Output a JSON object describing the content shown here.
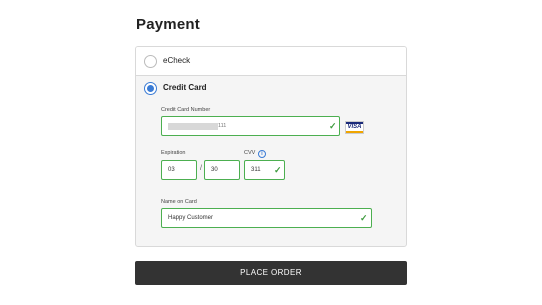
{
  "page_title": "Payment",
  "payment_options": {
    "echeck_label": "eCheck",
    "credit_card_label": "Credit Card",
    "selected": "Credit Card"
  },
  "card": {
    "number_label": "Credit Card Number",
    "number_suffix": "111",
    "brand": "VISA",
    "expiration_label": "Expiration",
    "exp_month": "03",
    "exp_separator": "/",
    "exp_year": "30",
    "cvv_label": "CVV",
    "cvv_value": "311",
    "name_label": "Name on Card",
    "name_value": "Happy Customer"
  },
  "icons": {
    "check": "check-icon",
    "info": "info-icon",
    "visa": "visa-icon"
  },
  "colors": {
    "accent": "#3a7bd5",
    "valid": "#4caf50",
    "button_bg": "#333333"
  },
  "place_order_label": "PLACE ORDER"
}
